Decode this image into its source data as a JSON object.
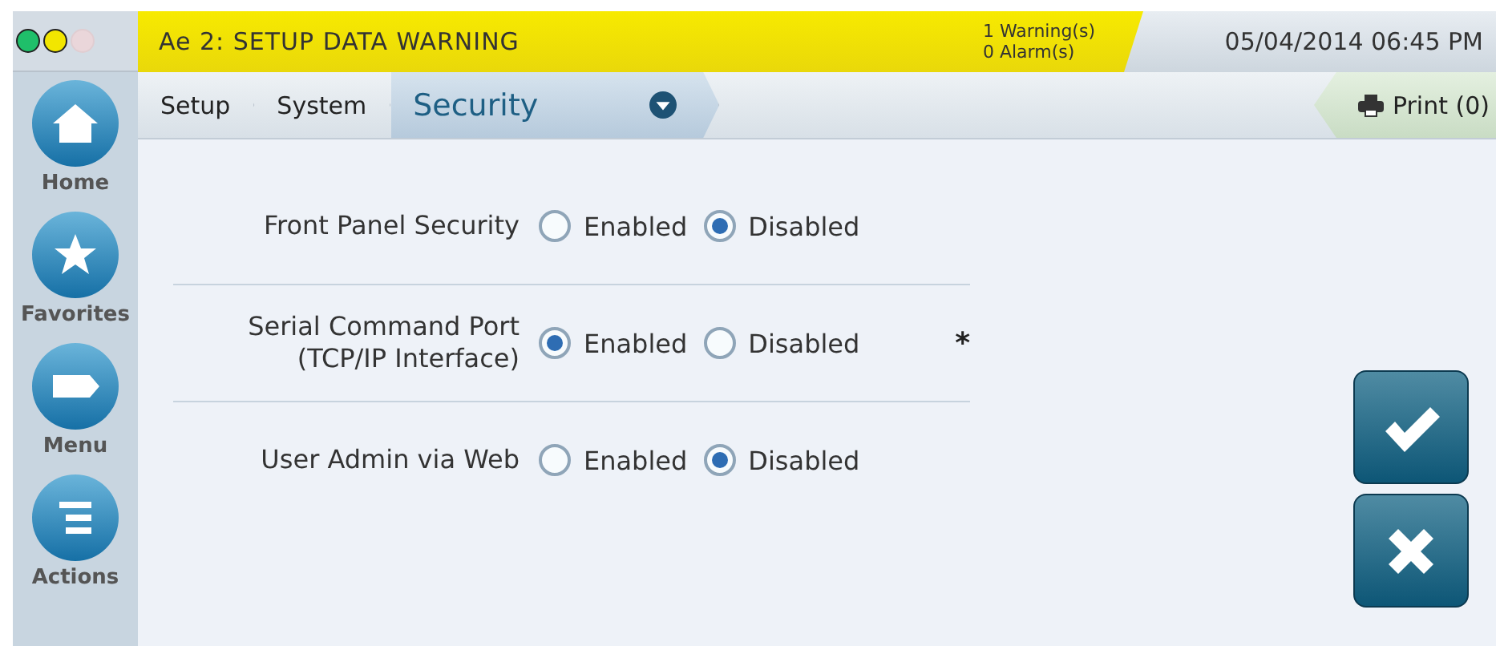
{
  "status_lights": [
    {
      "color": "#1fbf6a",
      "on": true
    },
    {
      "color": "#f2e600",
      "on": true
    },
    {
      "color": "#ead6da",
      "on": false
    }
  ],
  "alarm_bar": {
    "title": "Ae 2: SETUP DATA WARNING",
    "warnings": "1 Warning(s)",
    "alarms": "0 Alarm(s)"
  },
  "datetime": "05/04/2014 06:45 PM",
  "breadcrumb": [
    {
      "label": "Setup",
      "selected": false
    },
    {
      "label": "System",
      "selected": false
    },
    {
      "label": "Security",
      "selected": true
    }
  ],
  "print_button": "Print (0)",
  "sidebar": {
    "items": [
      {
        "label": "Home",
        "kind": "home"
      },
      {
        "label": "Favorites",
        "kind": "star"
      },
      {
        "label": "Menu",
        "kind": "tag"
      },
      {
        "label": "Actions",
        "kind": "list"
      }
    ]
  },
  "settings": [
    {
      "label": "Front Panel Security",
      "options": [
        {
          "label": "Enabled",
          "selected": false
        },
        {
          "label": "Disabled",
          "selected": true
        }
      ]
    },
    {
      "label": "Serial Command Port\n(TCP/IP Interface)",
      "options": [
        {
          "label": "Enabled",
          "selected": true
        },
        {
          "label": "Disabled",
          "selected": false
        }
      ],
      "note": "*"
    },
    {
      "label": "User Admin via Web",
      "options": [
        {
          "label": "Enabled",
          "selected": false
        },
        {
          "label": "Disabled",
          "selected": true
        }
      ]
    }
  ],
  "actions": [
    {
      "kind": "accept"
    },
    {
      "kind": "cancel"
    }
  ]
}
